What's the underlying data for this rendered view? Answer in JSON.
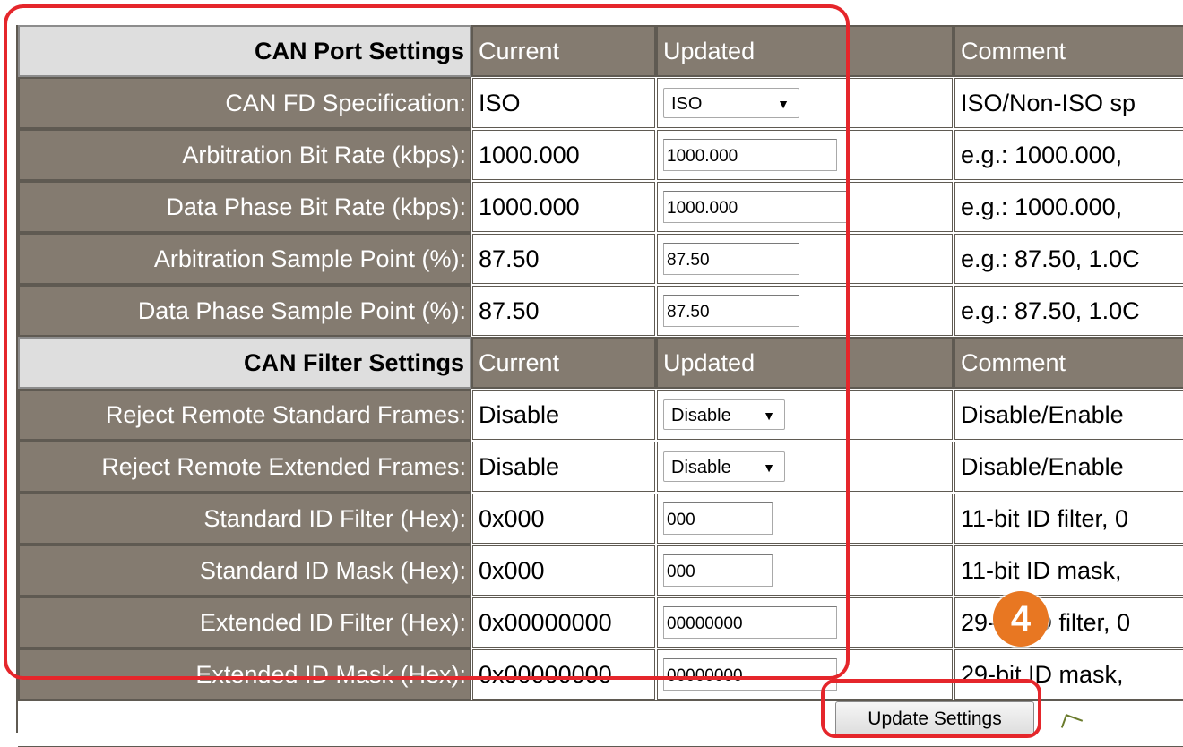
{
  "sections": [
    {
      "title": "CAN Port Settings",
      "current_label": "Current",
      "updated_label": "Updated",
      "comment_label": "Comment",
      "rows": [
        {
          "label": "CAN FD Specification:",
          "current": "ISO",
          "updated": "ISO",
          "control": "select",
          "comment": "ISO/Non-ISO sp"
        },
        {
          "label": "Arbitration Bit Rate (kbps):",
          "current": "1000.000",
          "updated": "1000.000",
          "control": "input",
          "comment": "e.g.: 1000.000,"
        },
        {
          "label": "Data Phase Bit Rate (kbps):",
          "current": "1000.000",
          "updated": "1000.000",
          "control": "input",
          "comment": "e.g.: 1000.000,"
        },
        {
          "label": "Arbitration Sample Point (%):",
          "current": "87.50",
          "updated": "87.50",
          "control": "input",
          "comment": "e.g.: 87.50, 1.0C"
        },
        {
          "label": "Data Phase Sample Point (%):",
          "current": "87.50",
          "updated": "87.50",
          "control": "input",
          "comment": "e.g.: 87.50, 1.0C"
        }
      ]
    },
    {
      "title": "CAN Filter Settings",
      "current_label": "Current",
      "updated_label": "Updated",
      "comment_label": "Comment",
      "rows": [
        {
          "label": "Reject Remote Standard Frames:",
          "current": "Disable",
          "updated": "Disable",
          "control": "select",
          "comment": "Disable/Enable"
        },
        {
          "label": "Reject Remote Extended Frames:",
          "current": "Disable",
          "updated": "Disable",
          "control": "select",
          "comment": "Disable/Enable"
        },
        {
          "label": "Standard ID Filter (Hex):",
          "current": "0x000",
          "updated": "000",
          "control": "input",
          "comment": "11-bit ID filter, 0"
        },
        {
          "label": "Standard ID Mask (Hex):",
          "current": "0x000",
          "updated": "000",
          "control": "input",
          "comment": "11-bit ID mask,"
        },
        {
          "label": "Extended ID Filter (Hex):",
          "current": "0x00000000",
          "updated": "00000000",
          "control": "input",
          "comment": "29-bit ID filter, 0"
        },
        {
          "label": "Extended ID Mask (Hex):",
          "current": "0x00000000",
          "updated": "00000000",
          "control": "input",
          "comment": "29-bit ID mask,"
        }
      ]
    }
  ],
  "update_button": "Update Settings",
  "step_badge": "4",
  "colors": {
    "header_bg": "#847b70",
    "section_bg": "#dedede",
    "highlight": "#e5262b",
    "badge": "#e87722"
  },
  "icons": {
    "dropdown": "triangle-down-icon",
    "cursor": "pointer-cursor-icon"
  }
}
